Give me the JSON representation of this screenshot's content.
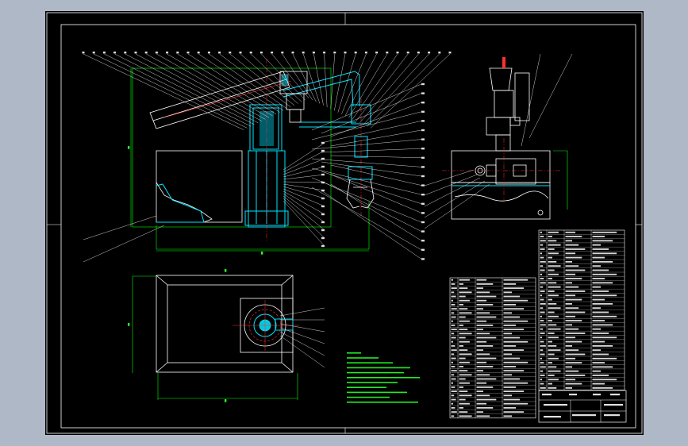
{
  "palette": {
    "background": "#aeb8c6",
    "sheet": "#000000",
    "outline": "#ffffff",
    "section": "#00e5ff",
    "dimension": "#00ff00",
    "center_line": "#ff3030",
    "leader": "#ffffff"
  },
  "views": {
    "front": {
      "name": "front-view"
    },
    "plan": {
      "name": "plan-view"
    },
    "side": {
      "name": "side-view"
    }
  },
  "title_block": {
    "name": "title-block"
  },
  "parts_list": {
    "name": "parts-list"
  },
  "notes": {
    "name": "technical-notes"
  }
}
